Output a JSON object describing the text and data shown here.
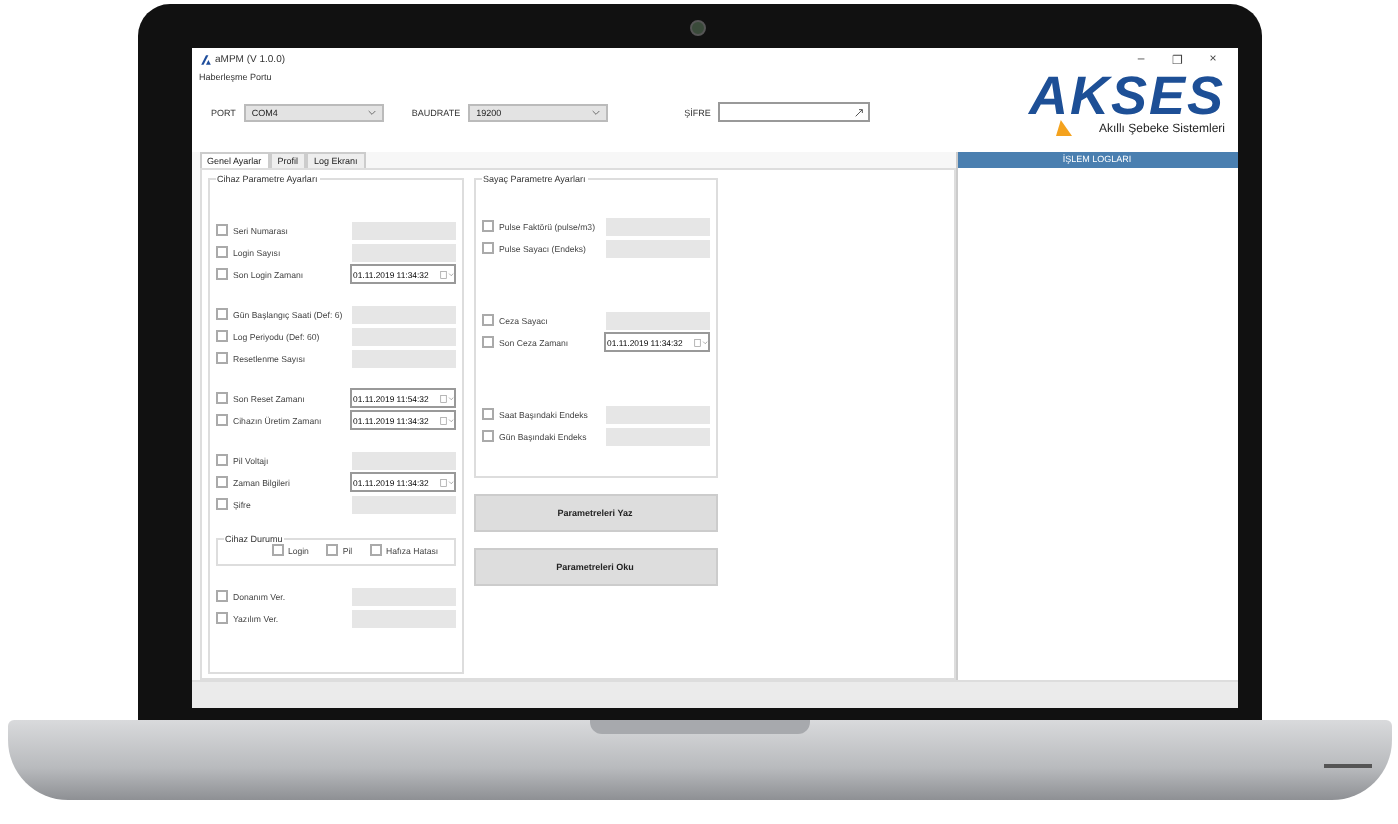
{
  "window": {
    "title": "aMPM (V 1.0.0)",
    "controls": [
      "–",
      "❐",
      "×"
    ]
  },
  "comm": {
    "title": "Haberleşme Portu",
    "port": {
      "label": "PORT",
      "value": "COM4"
    },
    "baudrate": {
      "label": "BAUDRATE",
      "value": "19200"
    },
    "password": {
      "label": "ŞİFRE"
    }
  },
  "logo": {
    "name": "AKSES",
    "tagline": "Akıllı Şebeke Sistemleri"
  },
  "tabs": [
    {
      "label": "Genel Ayarlar",
      "selected": true
    },
    {
      "label": "Profil",
      "selected": false
    },
    {
      "label": "Log Ekranı",
      "selected": false
    }
  ],
  "device_params": {
    "title": "Cihaz Parametre Ayarları",
    "sections": [
      [
        {
          "label": "Seri Numarası",
          "checked": false,
          "kind": "text"
        },
        {
          "label": "Login Sayısı",
          "checked": false,
          "kind": "text"
        },
        {
          "label": "Son Login Zamanı",
          "checked": false,
          "kind": "date",
          "value": "01.11.2019 11:34:32"
        }
      ],
      [
        {
          "label": "Gün Başlangıç Saati (Def: 6)",
          "checked": false,
          "kind": "text"
        },
        {
          "label": "Log Periyodu (Def: 60)",
          "checked": false,
          "kind": "text"
        },
        {
          "label": "Resetlenme Sayısı",
          "checked": false,
          "kind": "text"
        }
      ],
      [
        {
          "label": "Son Reset Zamanı",
          "checked": false,
          "kind": "date",
          "value": "01.11.2019 11:54:32"
        },
        {
          "label": "Cihazın Üretim Zamanı",
          "checked": false,
          "kind": "date",
          "value": "01.11.2019 11:34:32"
        }
      ],
      [
        {
          "label": "Pil Voltajı",
          "checked": false,
          "kind": "text"
        },
        {
          "label": "Zaman Bilgileri",
          "checked": false,
          "kind": "date",
          "value": "01.11.2019 11:34:32"
        },
        {
          "label": "Şifre",
          "checked": false,
          "kind": "text"
        }
      ]
    ]
  },
  "device_status": {
    "title": "Cihaz Durumu",
    "items": [
      {
        "label": "Login",
        "checked": false
      },
      {
        "label": "Pil",
        "checked": false
      },
      {
        "label": "Hafıza Hatası",
        "checked": false
      }
    ]
  },
  "versions": [
    {
      "label": "Donanım Ver.",
      "checked": false,
      "kind": "text"
    },
    {
      "label": "Yazılım Ver.",
      "checked": false,
      "kind": "text"
    }
  ],
  "meter_params": {
    "title": "Sayaç Parametre Ayarları",
    "sections": [
      [
        {
          "label": "Pulse Faktörü (pulse/m3)",
          "checked": false,
          "kind": "text"
        },
        {
          "label": "Pulse Sayacı (Endeks)",
          "checked": false,
          "kind": "text"
        }
      ],
      [
        {
          "label": "Ceza Sayacı",
          "checked": false,
          "kind": "text"
        },
        {
          "label": "Son Ceza Zamanı",
          "checked": false,
          "kind": "date",
          "value": "01.11.2019 11:34:32"
        }
      ],
      [
        {
          "label": "Saat Başındaki Endeks",
          "checked": false,
          "kind": "text"
        },
        {
          "label": "Gün Başındaki Endeks",
          "checked": false,
          "kind": "text"
        }
      ]
    ]
  },
  "buttons": [
    "Parametreleri Yaz",
    "Parametreleri Oku"
  ],
  "log_panel": {
    "title": "İŞLEM LOGLARI"
  }
}
